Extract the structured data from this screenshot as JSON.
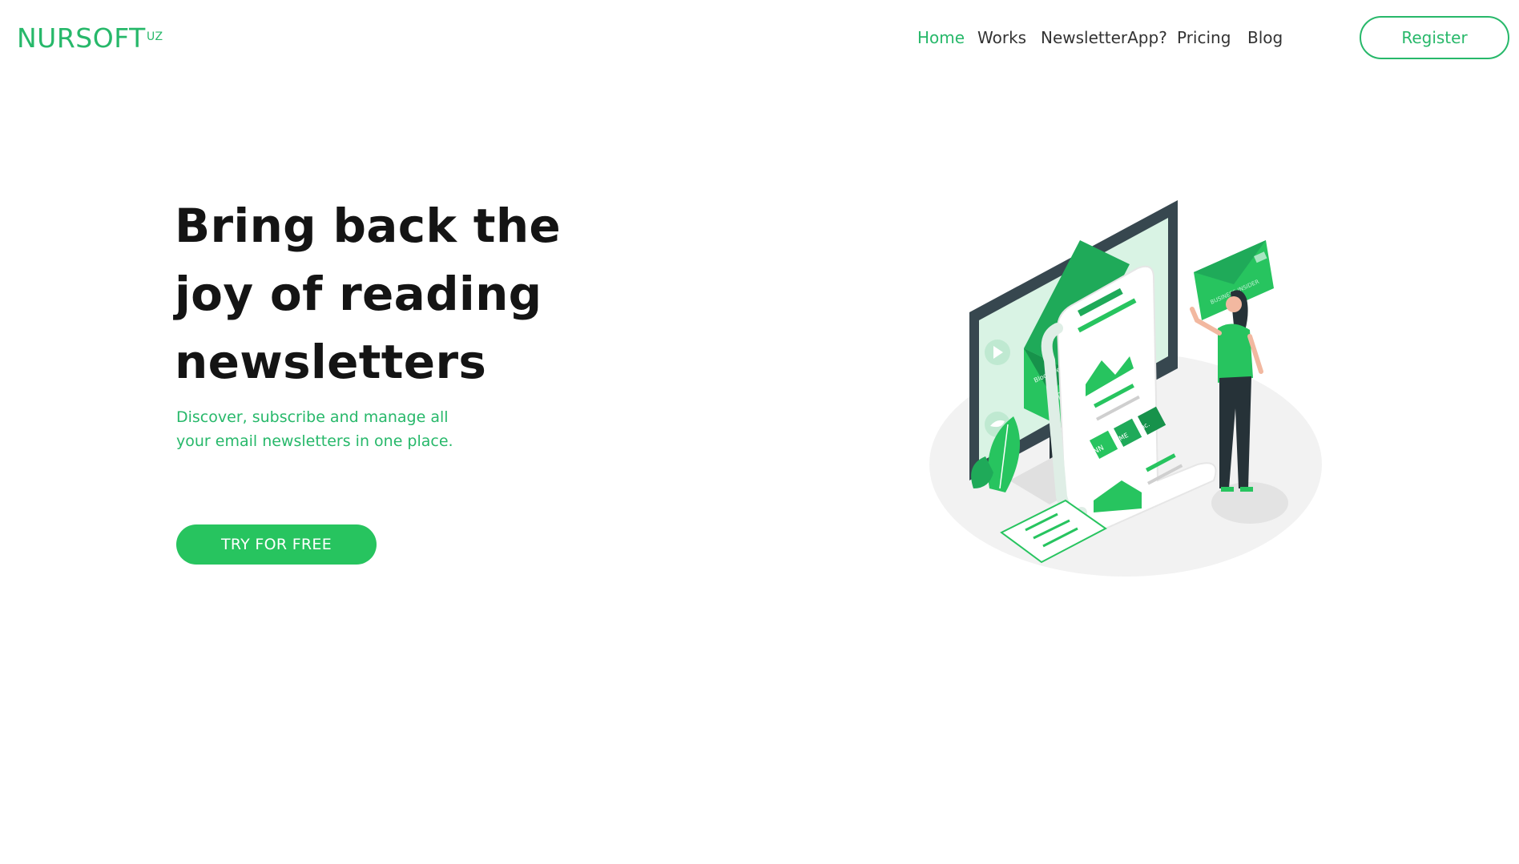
{
  "brand": {
    "name": "NURSOFT",
    "suffix": "UZ",
    "accent": "#27b86a",
    "button_color": "#27c45f"
  },
  "nav": {
    "items": [
      {
        "label": "Home",
        "active": true
      },
      {
        "label": "Works",
        "active": false
      },
      {
        "label": "NewsletterApp?",
        "active": false
      },
      {
        "label": "Pricing",
        "active": false
      },
      {
        "label": "Blog",
        "active": false
      }
    ],
    "register_label": "Register"
  },
  "hero": {
    "title_lines": [
      "Bring back the",
      "joy of reading",
      "newsletters"
    ],
    "subtitle_lines": [
      "Discover, subscribe and manage all",
      "your email newsletters in one place."
    ],
    "cta_label": "TRY FOR FREE"
  },
  "illustration": {
    "icons": [
      "monitor-icon",
      "envelope-icon",
      "newsletter-scroll-icon",
      "person-icon",
      "plant-icon",
      "checklist-icon",
      "youtube-icon",
      "twitter-icon"
    ],
    "labels": [
      "Bloomberg",
      "TC",
      "CNN",
      "TIME",
      "Inc.",
      "BUSINESS INSIDER"
    ]
  }
}
